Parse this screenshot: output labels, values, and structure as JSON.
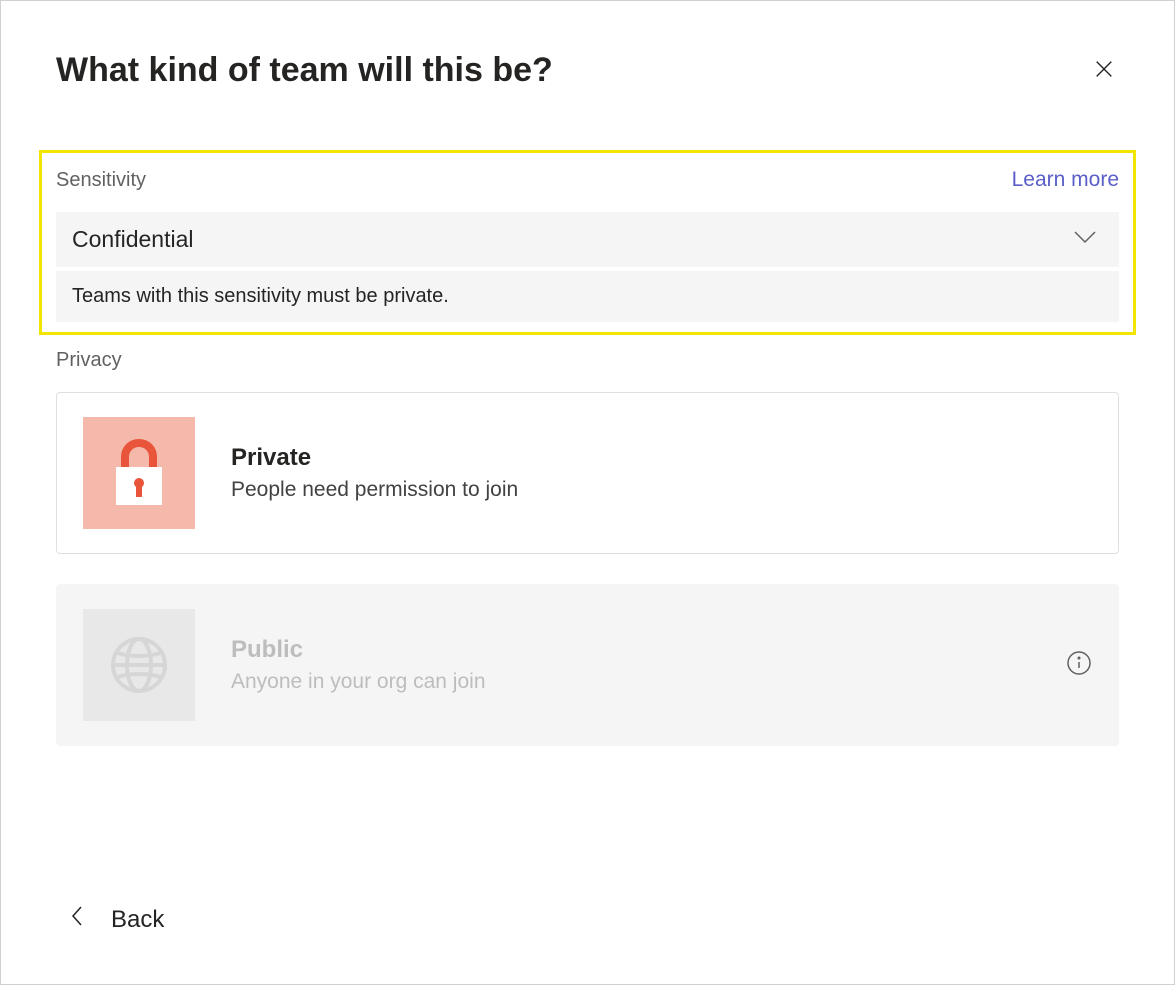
{
  "header": {
    "title": "What kind of team will this be?"
  },
  "sensitivity": {
    "label": "Sensitivity",
    "learn_more": "Learn more",
    "selected": "Confidential",
    "note": "Teams with this sensitivity must be private."
  },
  "privacy": {
    "label": "Privacy",
    "options": {
      "private": {
        "title": "Private",
        "description": "People need permission to join"
      },
      "public": {
        "title": "Public",
        "description": "Anyone in your org can join"
      }
    }
  },
  "footer": {
    "back": "Back"
  }
}
